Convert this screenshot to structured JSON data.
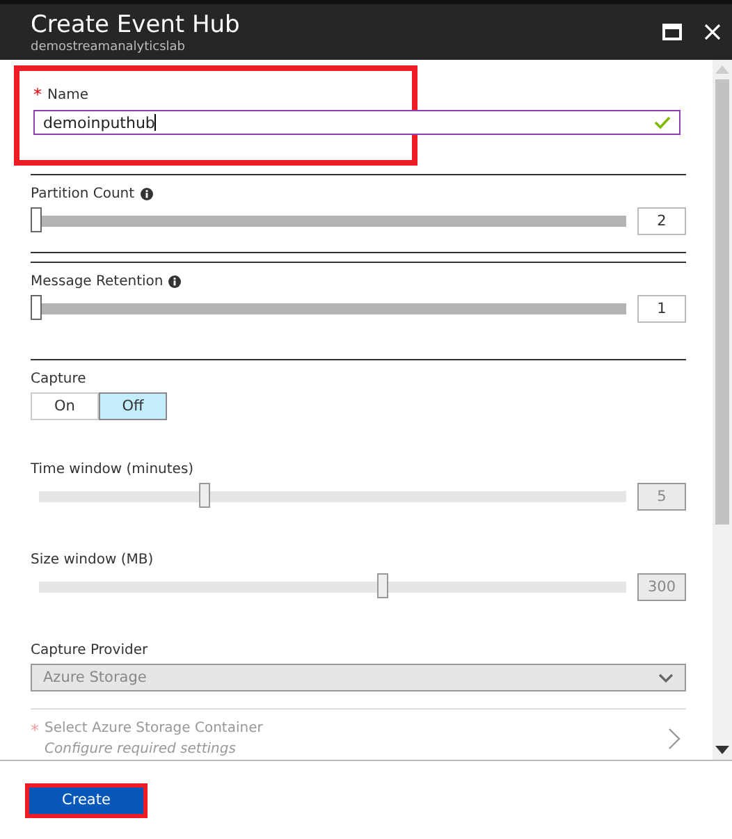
{
  "window": {
    "title": "Create Event Hub",
    "subtitle": "demostreamanalyticslab"
  },
  "name_field": {
    "label": "Name",
    "required_mark": "*",
    "value": "demoinputhub",
    "valid": true,
    "highlighted": true
  },
  "sliders": [
    {
      "label": "Partition Count",
      "info": true,
      "level": 0,
      "value": "2",
      "disabled": false
    },
    {
      "label": "Message Retention",
      "info": true,
      "level": 0,
      "value": "1",
      "disabled": false
    }
  ],
  "capture": {
    "label": "Capture",
    "options": [
      {
        "label": "On",
        "selected": false
      },
      {
        "label": "Off",
        "selected": true
      }
    ]
  },
  "capture_sliders": [
    {
      "label": "Time window (minutes)",
      "level": 0.28,
      "value": "5",
      "disabled": true
    },
    {
      "label": "Size window (MB)",
      "level": 0.59,
      "value": "300",
      "disabled": true
    }
  ],
  "capture_provider": {
    "label": "Capture Provider",
    "value": "Azure Storage",
    "disabled": true
  },
  "storage_container": {
    "label": "Select Azure Storage Container",
    "required_mark": "*",
    "hint": "Configure required settings",
    "disabled": true
  },
  "create_button": {
    "label": "Create",
    "highlighted": true
  }
}
